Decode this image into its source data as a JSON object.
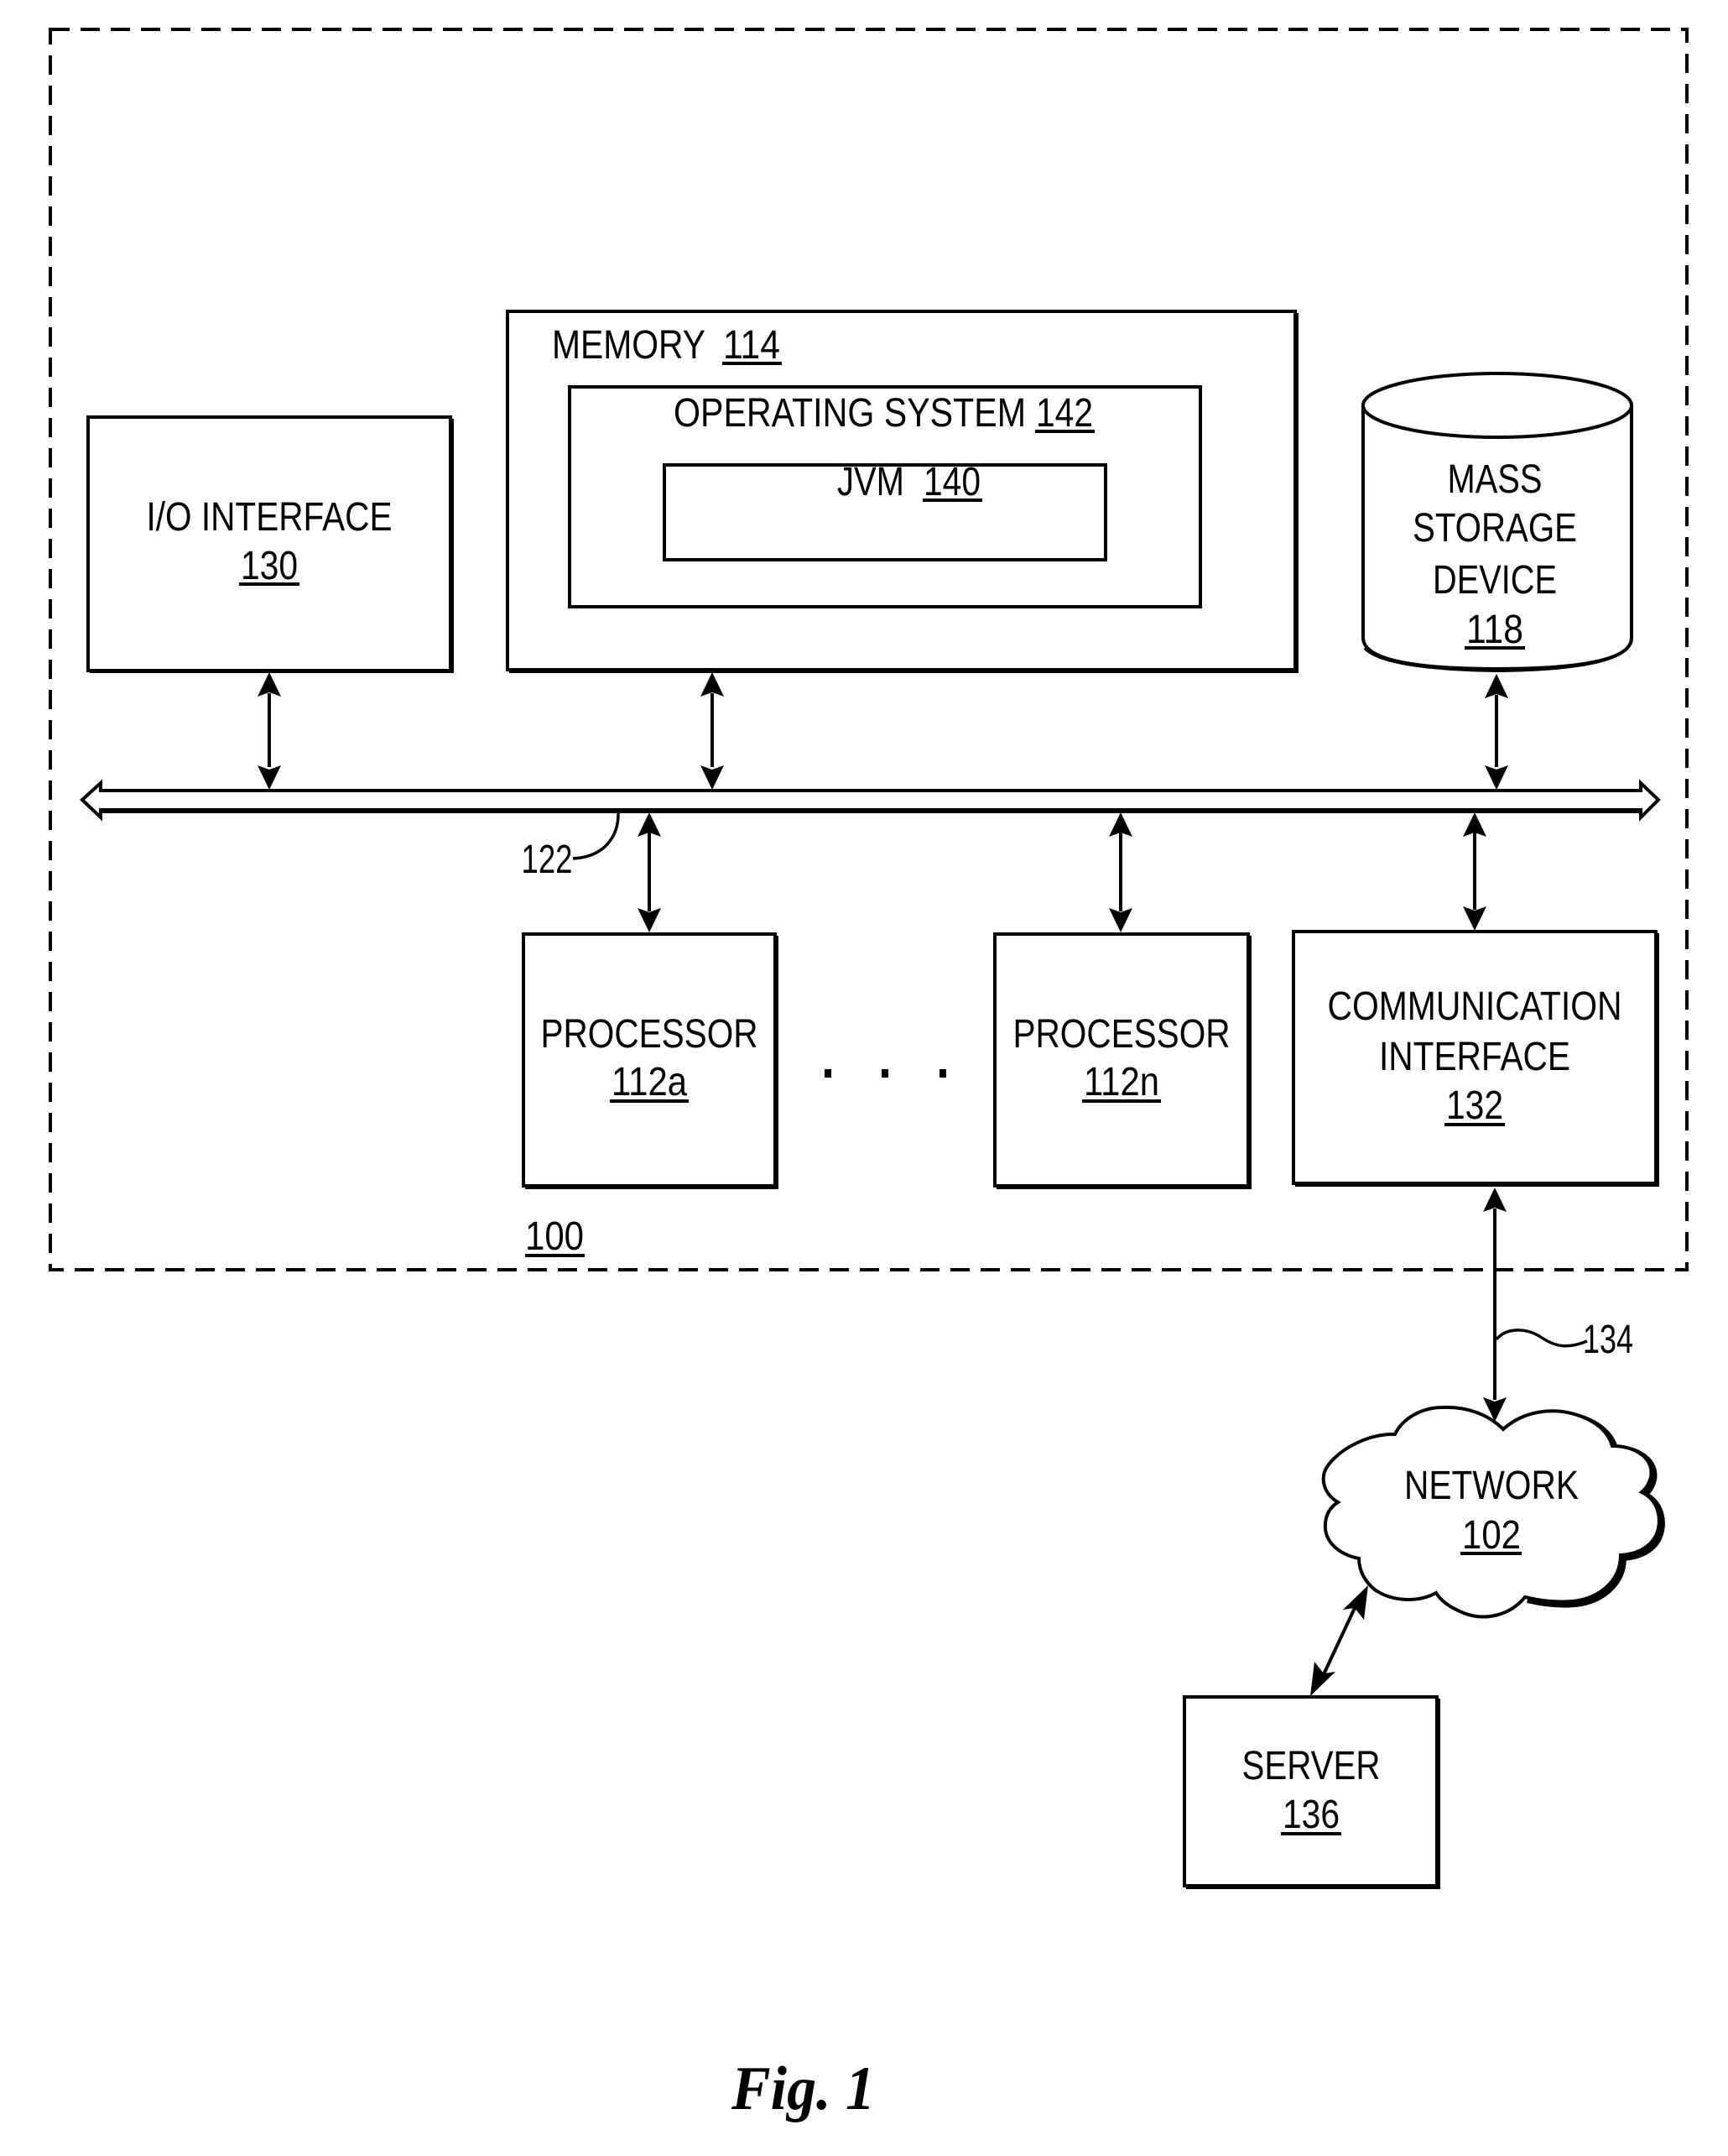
{
  "figure": {
    "caption": "Fig. 1",
    "system_ref": "100"
  },
  "colors": {
    "ink": "#000000",
    "background": "#ffffff"
  },
  "components": {
    "io_interface": {
      "lines": [
        "I/O INTERFACE"
      ],
      "ref": "130"
    },
    "memory": {
      "label": "MEMORY",
      "ref": "114"
    },
    "operating_system": {
      "label": "OPERATING SYSTEM",
      "ref": "142"
    },
    "jvm": {
      "label": "JVM",
      "ref": "140"
    },
    "mass_storage": {
      "lines": [
        "MASS",
        "STORAGE",
        "DEVICE"
      ],
      "ref": "118"
    },
    "bus": {
      "ref": "122"
    },
    "processor_a": {
      "lines": [
        "PROCESSOR"
      ],
      "ref": "112a"
    },
    "processor_n": {
      "lines": [
        "PROCESSOR"
      ],
      "ref": "112n"
    },
    "ellipsis": "...",
    "communication_interface": {
      "lines": [
        "COMMUNICATION",
        "INTERFACE"
      ],
      "ref": "132"
    },
    "link": {
      "ref": "134"
    },
    "network": {
      "lines": [
        "NETWORK"
      ],
      "ref": "102"
    },
    "server": {
      "lines": [
        "SERVER"
      ],
      "ref": "136"
    }
  }
}
